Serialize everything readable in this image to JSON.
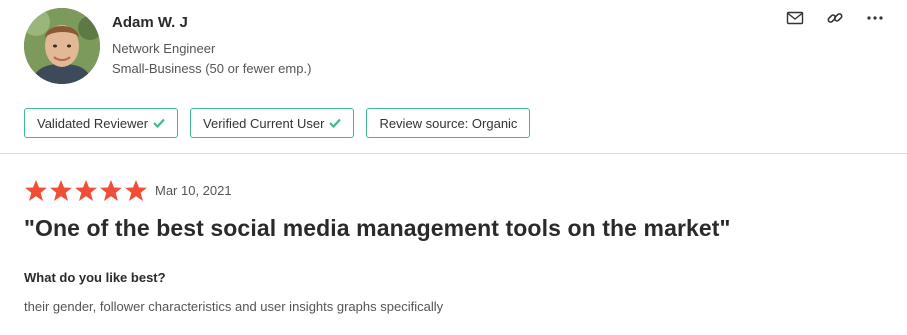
{
  "reviewer": {
    "name": "Adam W. J",
    "title": "Network Engineer",
    "company_size": "Small-Business (50 or fewer emp.)"
  },
  "actions": {
    "icons": [
      "mail-icon",
      "link-icon",
      "more-icon"
    ]
  },
  "badges": [
    {
      "label": "Validated Reviewer",
      "checked": true
    },
    {
      "label": "Verified Current User",
      "checked": true
    },
    {
      "label": "Review source: Organic",
      "checked": false
    }
  ],
  "review": {
    "rating": 5,
    "max_rating": 5,
    "date": "Mar 10, 2021",
    "title": "\"One of the best social media management tools on the market\"",
    "question": "What do you like best?",
    "answer": "their gender, follower characteristics and user insights graphs specifically"
  },
  "colors": {
    "star": "#f04e37",
    "badge_border": "#3fb89b",
    "check": "#3fb89b",
    "divider": "#d9d9d9"
  }
}
